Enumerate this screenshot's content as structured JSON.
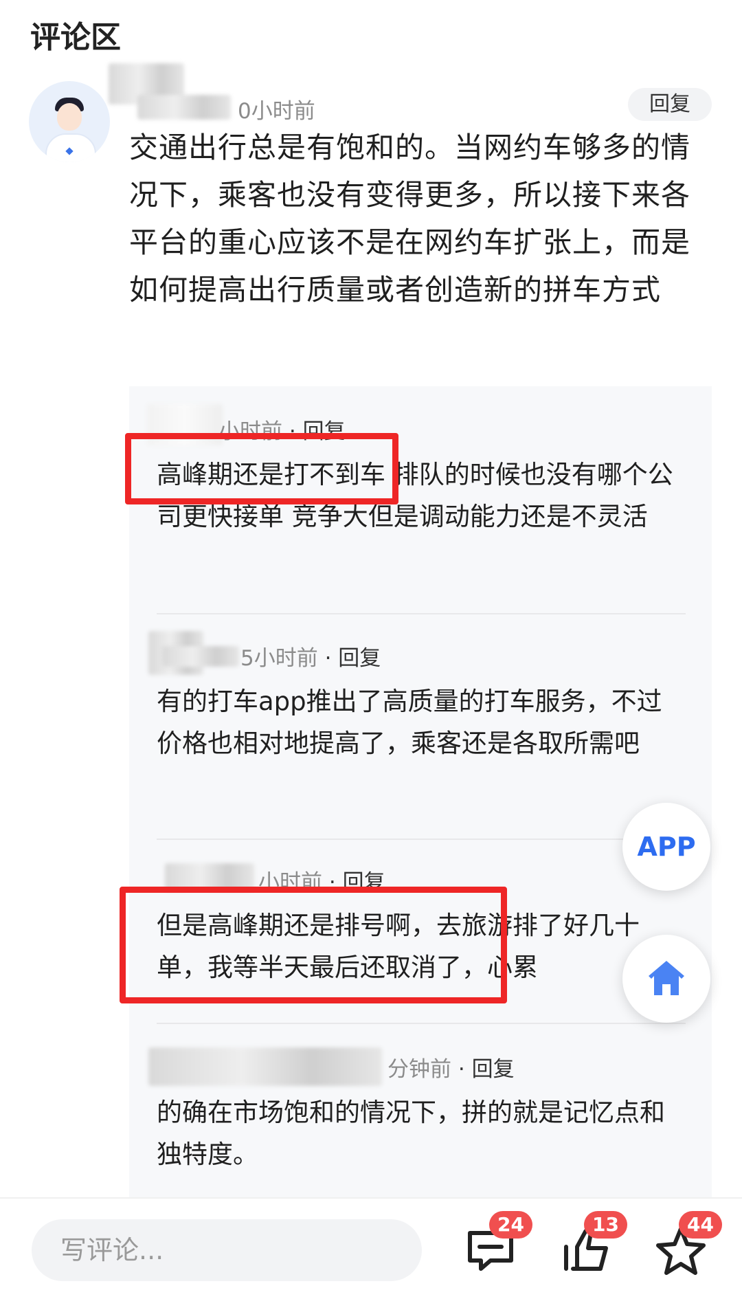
{
  "section_title": "评论区",
  "main_comment": {
    "time": "0小时前",
    "reply_label": "回复",
    "text": "交通出行总是有饱和的。当网约车够多的情况下，乘客也没有变得更多，所以接下来各平台的重心应该不是在网约车扩张上，而是如何提高出行质量或者创造新的拼车方式"
  },
  "replies": [
    {
      "time": "小时前",
      "action": "· 回复",
      "text": "高峰期还是打不到车 排队的时候也没有哪个公司更快接单 竞争大但是调动能力还是不灵活"
    },
    {
      "time": "5小时前",
      "action": "· 回复",
      "text": "有的打车app推出了高质量的打车服务，不过价格也相对地提高了，乘客还是各取所需吧"
    },
    {
      "time": "小时前",
      "action": "· 回复",
      "text": "但是高峰期还是排号啊，去旅游排了好几十单，我等半天最后还取消了，心累"
    },
    {
      "time": "分钟前",
      "action": "· 回复",
      "text": "的确在市场饱和的情况下，拼的就是记忆点和独特度。"
    }
  ],
  "fab": {
    "app_label": "APP",
    "home_icon": "home-icon"
  },
  "bottom_bar": {
    "placeholder": "写评论...",
    "comment_count": "24",
    "share_count": "13",
    "favorite_count": "44",
    "icons": [
      "comment-icon",
      "share-icon",
      "star-icon"
    ]
  },
  "colors": {
    "highlight": "#ee2626",
    "accent": "#2d6cf0",
    "badge": "#f04f4f"
  }
}
